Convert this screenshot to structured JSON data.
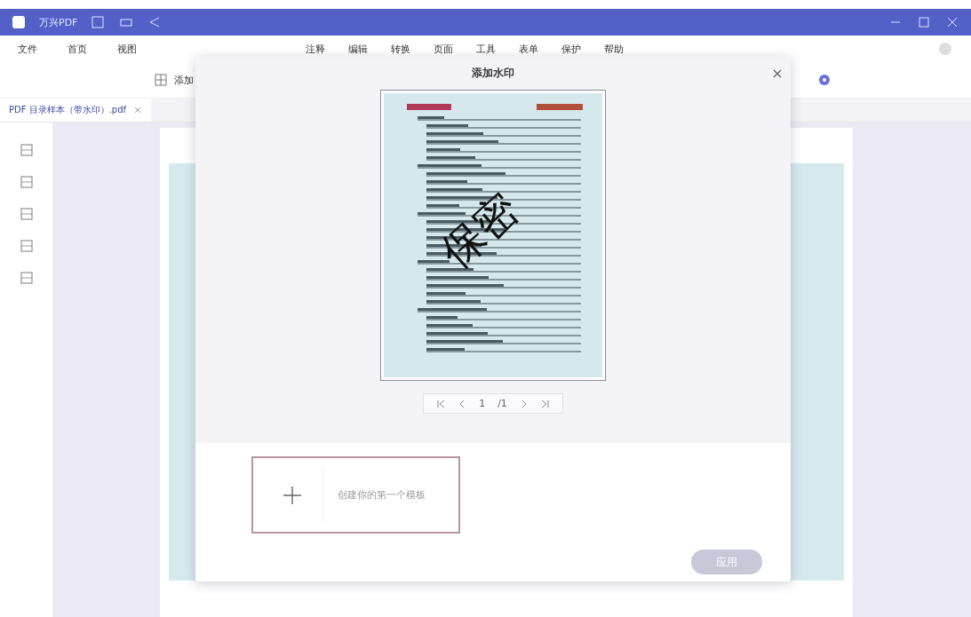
{
  "title_bar": {
    "app_name": "万兴PDF"
  },
  "menu_bar": {
    "left_items": [
      {
        "label": "文件"
      },
      {
        "label": "首页"
      },
      {
        "label": "视图"
      }
    ],
    "center_items": [
      {
        "label": "注释"
      },
      {
        "label": "编辑"
      },
      {
        "label": "转换"
      },
      {
        "label": "页面"
      },
      {
        "label": "工具"
      },
      {
        "label": "表单"
      },
      {
        "label": "保护"
      },
      {
        "label": "帮助"
      }
    ]
  },
  "toolbar": {
    "label": "添加"
  },
  "document_tab": {
    "label": "PDF 目录样本（带水印）.pdf"
  },
  "dialog": {
    "title": "添加水印",
    "preview": {
      "watermark_text": "保密",
      "pager": {
        "page": "1",
        "total": "/1"
      }
    },
    "template_card": {
      "label": "创建你的第一个模板"
    },
    "apply_button": {
      "label": "应用",
      "disabled": true
    }
  }
}
